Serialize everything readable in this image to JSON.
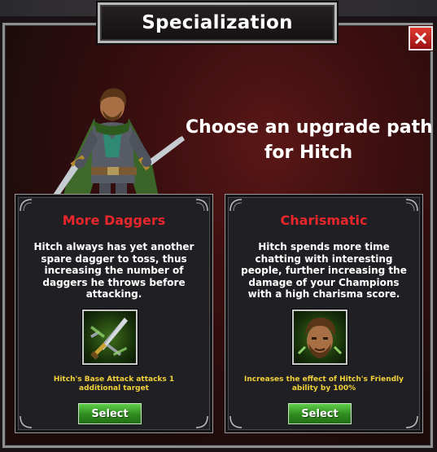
{
  "dialog": {
    "title": "Specialization",
    "close_label": "✕",
    "heading_line1": "Choose an upgrade path",
    "heading_line2": "for Hitch"
  },
  "options": [
    {
      "title": "More Daggers",
      "description": "Hitch always has yet another spare dagger to toss, thus increasing the number of daggers he throws before attacking.",
      "effect": "Hitch's Base Attack attacks 1 additional target",
      "button_label": "Select",
      "icon": "daggers-icon"
    },
    {
      "title": "Charismatic",
      "description": "Hitch spends more time chatting with interesting people, further increasing the damage of your Champions with a high charisma score.",
      "effect": "Increases the effect of Hitch's Friendly ability by 100%",
      "button_label": "Select",
      "icon": "hitch-portrait-icon"
    }
  ],
  "colors": {
    "option_title": "#e8262b",
    "effect_text": "#f2d23a",
    "select_button": "#3fa52a",
    "close_button": "#c8221e"
  }
}
